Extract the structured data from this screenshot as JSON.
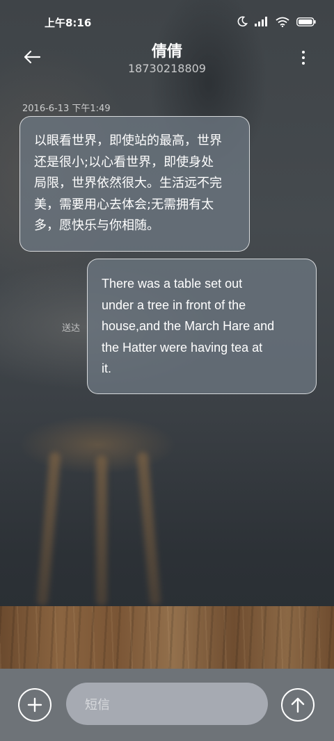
{
  "status_bar": {
    "time": "上午8:16",
    "icons": [
      "moon-icon",
      "signal-icon",
      "wifi-icon",
      "battery-icon"
    ]
  },
  "header": {
    "contact_name": "倩倩",
    "phone_number": "18730218809"
  },
  "conversation": {
    "timestamp": "2016-6-13 下午1:49",
    "messages": [
      {
        "direction": "incoming",
        "lines": [
          "以眼看世界，即使站的最高，世界",
          "还是很小;以心看世界，即使身处",
          "局限，世界依然很大。生活远不完",
          "美，需要用心去体会;无需拥有太",
          "多，愿快乐与你相随。"
        ]
      },
      {
        "direction": "outgoing",
        "status": "送达",
        "lines": [
          "There was a table set out",
          "under a tree in front of the",
          "house,and the March Hare and",
          "the Hatter were having tea at",
          "it."
        ]
      }
    ]
  },
  "composer": {
    "placeholder": "短信",
    "add_icon": "plus-icon",
    "send_icon": "arrow-up-icon"
  }
}
